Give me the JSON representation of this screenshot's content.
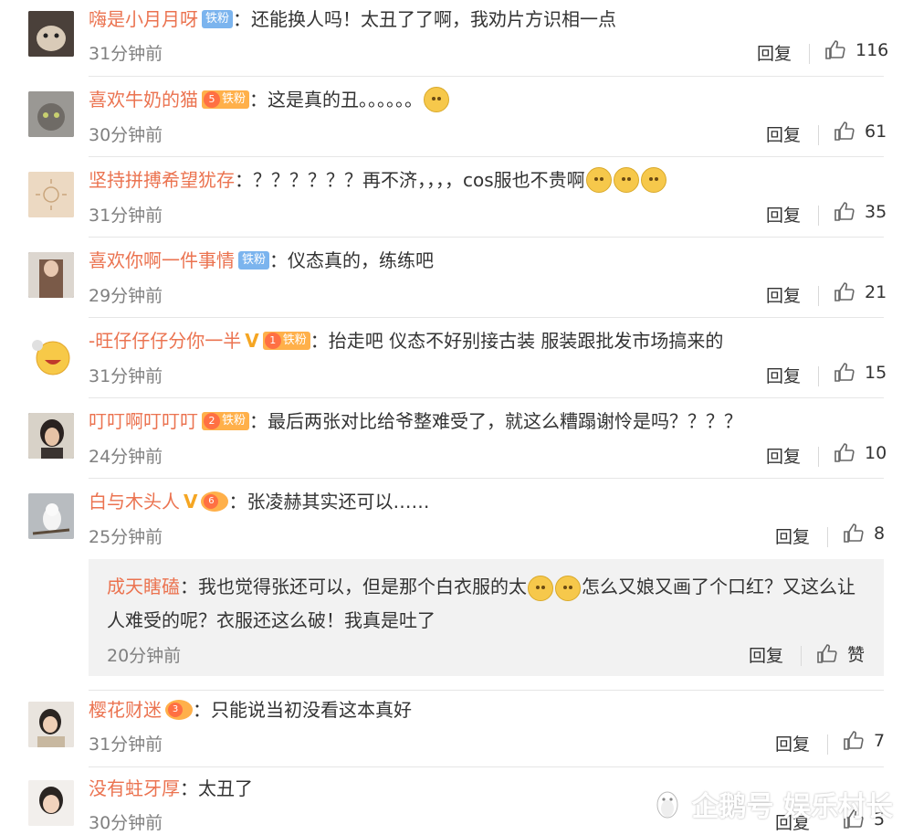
{
  "comments": [
    {
      "name": "嗨是小月月呀",
      "badge": "铁粉",
      "badge_type": "blue",
      "text": "：还能换人吗！太丑了了啊，我劝片方识相一点",
      "time": "31分钟前",
      "reply": "回复",
      "likes": "116"
    },
    {
      "name": "喜欢牛奶的猫",
      "badge": "铁粉",
      "badge_level": "5",
      "badge_type": "fan",
      "text": "：这是真的丑。。。。。。",
      "emoji_after": 1,
      "time": "30分钟前",
      "reply": "回复",
      "likes": "61"
    },
    {
      "name": "坚持拼搏希望犹存",
      "text": "：？？？？？？再不济，，，，cos服也不贵啊",
      "emoji_after": 3,
      "time": "31分钟前",
      "reply": "回复",
      "likes": "35"
    },
    {
      "name": "喜欢你啊一件事情",
      "badge": "铁粉",
      "badge_type": "blue",
      "text": "：仪态真的，练练吧",
      "time": "29分钟前",
      "reply": "回复",
      "likes": "21"
    },
    {
      "name": "-旺仔仔仔分你一半",
      "verified": "V",
      "badge": "铁粉",
      "badge_level": "1",
      "badge_type": "fan",
      "text": "：抬走吧 仪态不好别接古装 服装跟批发市场搞来的",
      "time": "31分钟前",
      "reply": "回复",
      "likes": "15"
    },
    {
      "name": "叮叮啊叮叮叮",
      "badge": "铁粉",
      "badge_level": "2",
      "badge_type": "fan",
      "text": "：最后两张对比给爷整难受了，就这么糟蹋谢怜是吗？？？？",
      "time": "24分钟前",
      "reply": "回复",
      "likes": "10"
    },
    {
      "name": "白与木头人",
      "verified": "V",
      "badge_level": "6",
      "badge_type": "fan-only",
      "text": "：张凌赫其实还可以……",
      "time": "25分钟前",
      "reply": "回复",
      "likes": "8"
    },
    {
      "name": "樱花财迷",
      "badge_level": "3",
      "badge_type": "fan-only",
      "text": "：只能说当初没看这本真好",
      "time": "31分钟前",
      "reply": "回复",
      "likes": "7"
    },
    {
      "name": "没有蛀牙厚",
      "text": "：太丑了",
      "time": "30分钟前",
      "reply": "回复",
      "likes": "5"
    }
  ],
  "sub_reply": {
    "name": "成天瞎磕",
    "text_before": "：我也觉得张还可以，但是那个白衣服的太",
    "text_after": "怎么又娘又画了个口红？又这么让人难受的呢？衣服还这么破！我真是吐了",
    "time": "20分钟前",
    "reply": "回复",
    "like": "赞"
  },
  "watermark": "企鹅号 娱乐村长"
}
